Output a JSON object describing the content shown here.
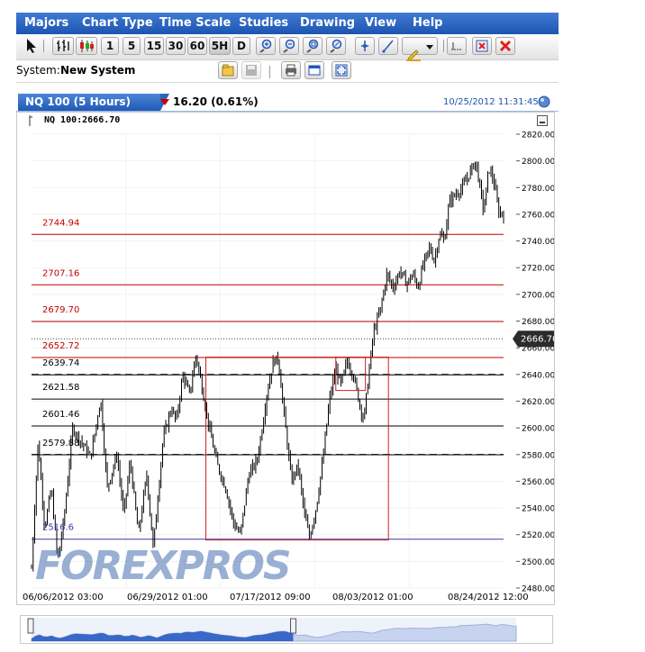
{
  "menu": [
    "Majors",
    "Chart Type",
    "Time Scale",
    "Studies",
    "Drawing",
    "View",
    "Help"
  ],
  "toolbar": {
    "intervals": [
      "1",
      "5",
      "15",
      "30",
      "60",
      "5H",
      "D"
    ],
    "selected_interval": "5H"
  },
  "system": {
    "label": "System:",
    "name": "New System"
  },
  "header": {
    "instrument_tab": "NQ 100 (5 Hours)",
    "change": "16.20 (0.61%)",
    "change_color": "#cc0000",
    "timestamp": "10/25/2012 11:31:45"
  },
  "watermark": "FOREXPROS",
  "chart_data": {
    "type": "candlestick",
    "title": "NQ 100:2666.70",
    "current_price": 2666.7,
    "current_price_label": "2666.70",
    "ylim": [
      2480,
      2820
    ],
    "y_ticks": [
      2480,
      2500,
      2520,
      2540,
      2560,
      2580,
      2600,
      2620,
      2640,
      2660,
      2680,
      2700,
      2720,
      2740,
      2760,
      2780,
      2800,
      2820
    ],
    "y_tick_labels": [
      "2480.00",
      "2500.00",
      "2520.00",
      "2540.00",
      "2560.00",
      "2580.00",
      "2600.00",
      "2620.00",
      "2640.00",
      "2660.00",
      "2680.00",
      "2700.00",
      "2720.00",
      "2740.00",
      "2760.00",
      "2780.00",
      "2800.00",
      "2820.00"
    ],
    "x_tick_labels": [
      "06/06/2012 03:00",
      "06/29/2012 01:00",
      "07/17/2012 09:00",
      "08/03/2012 01:00",
      "08/24/2012 12:00"
    ],
    "price_path": [
      [
        0,
        2495
      ],
      [
        4,
        2590
      ],
      [
        8,
        2525
      ],
      [
        12,
        2555
      ],
      [
        16,
        2500
      ],
      [
        20,
        2535
      ],
      [
        25,
        2600
      ],
      [
        30,
        2590
      ],
      [
        36,
        2578
      ],
      [
        42,
        2622
      ],
      [
        46,
        2555
      ],
      [
        52,
        2580
      ],
      [
        56,
        2535
      ],
      [
        60,
        2575
      ],
      [
        65,
        2520
      ],
      [
        70,
        2565
      ],
      [
        74,
        2510
      ],
      [
        80,
        2592
      ],
      [
        85,
        2615
      ],
      [
        88,
        2605
      ],
      [
        92,
        2640
      ],
      [
        96,
        2625
      ],
      [
        100,
        2655
      ],
      [
        104,
        2628
      ],
      [
        108,
        2600
      ],
      [
        113,
        2572
      ],
      [
        118,
        2555
      ],
      [
        123,
        2528
      ],
      [
        127,
        2520
      ],
      [
        132,
        2565
      ],
      [
        137,
        2575
      ],
      [
        140,
        2598
      ],
      [
        143,
        2625
      ],
      [
        147,
        2650
      ],
      [
        150,
        2652
      ],
      [
        154,
        2605
      ],
      [
        158,
        2560
      ],
      [
        162,
        2572
      ],
      [
        166,
        2535
      ],
      [
        169,
        2518
      ],
      [
        173,
        2540
      ],
      [
        177,
        2575
      ],
      [
        181,
        2620
      ],
      [
        185,
        2645
      ],
      [
        188,
        2632
      ],
      [
        192,
        2650
      ],
      [
        196,
        2638
      ],
      [
        200,
        2615
      ],
      [
        202,
        2606
      ],
      [
        205,
        2640
      ],
      [
        208,
        2672
      ],
      [
        212,
        2688
      ],
      [
        216,
        2715
      ],
      [
        220,
        2705
      ],
      [
        224,
        2718
      ],
      [
        228,
        2708
      ],
      [
        232,
        2715
      ],
      [
        235,
        2705
      ],
      [
        238,
        2722
      ],
      [
        242,
        2735
      ],
      [
        245,
        2725
      ],
      [
        248,
        2745
      ],
      [
        251,
        2740
      ],
      [
        254,
        2770
      ],
      [
        258,
        2775
      ],
      [
        262,
        2780
      ],
      [
        266,
        2790
      ],
      [
        270,
        2800
      ],
      [
        272,
        2785
      ],
      [
        275,
        2762
      ],
      [
        278,
        2795
      ],
      [
        281,
        2785
      ],
      [
        284,
        2762
      ],
      [
        287,
        2760
      ]
    ],
    "fib_levels": [
      {
        "value": 2744.94,
        "label": "2744.94",
        "color": "#c00000"
      },
      {
        "value": 2707.16,
        "label": "2707.16",
        "color": "#c00000"
      },
      {
        "value": 2679.7,
        "label": "2679.70",
        "color": "#c00000"
      },
      {
        "value": 2652.72,
        "label": "2652.72",
        "color": "#c00000"
      },
      {
        "value": 2639.74,
        "label": "2639.74",
        "color": "#000000"
      },
      {
        "value": 2621.58,
        "label": "2621.58",
        "color": "#000000"
      },
      {
        "value": 2601.46,
        "label": "2601.46",
        "color": "#000000"
      },
      {
        "value": 2579.88,
        "label": "2579.88",
        "color": "#000000"
      },
      {
        "value": 2516.6,
        "label": "2516.6",
        "color": "#3a3aa8"
      }
    ],
    "dashed_levels": [
      2640,
      2580
    ],
    "dotted_level": 2666.7,
    "rectangles": [
      {
        "x0": 106,
        "x1": 217,
        "y0": 2516,
        "y1": 2653,
        "color": "#d02020"
      },
      {
        "x0": 185,
        "x1": 203,
        "y0": 2628,
        "y1": 2653,
        "color": "#d02020"
      }
    ],
    "colors": {
      "bars": "#000000",
      "fib": "#c00000",
      "navigator_fill": "#3868c8"
    }
  }
}
